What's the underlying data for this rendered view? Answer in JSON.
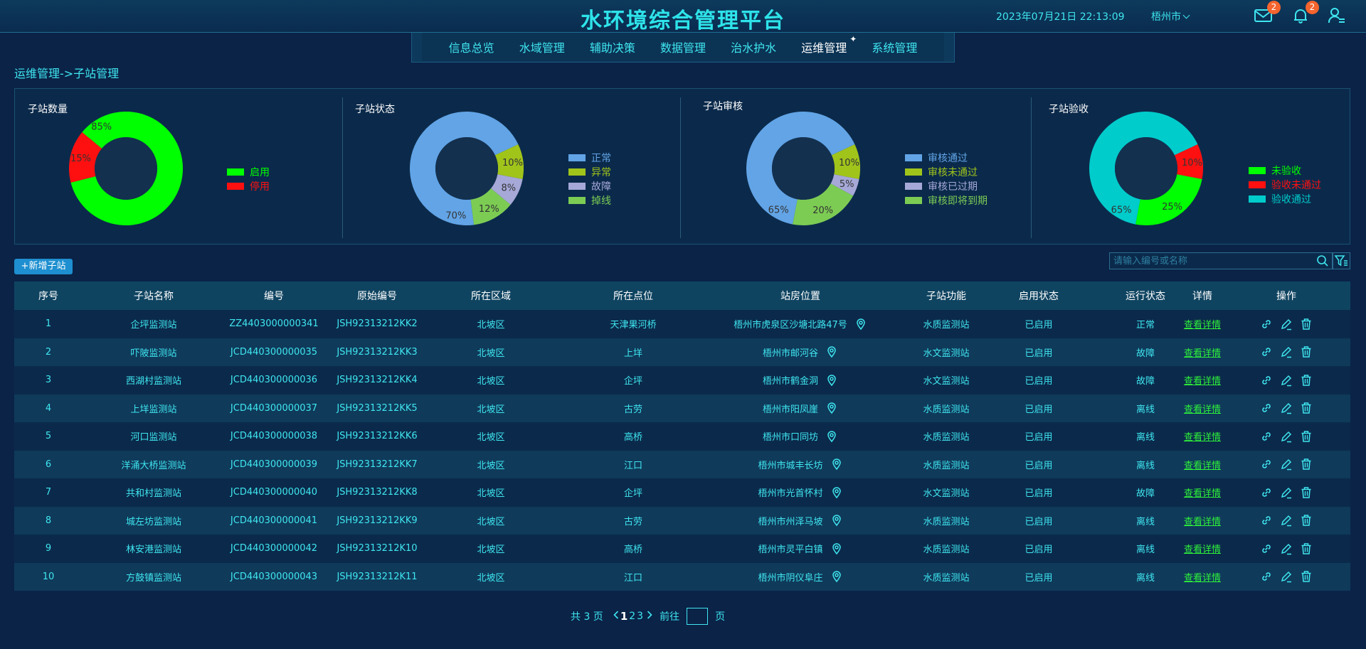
{
  "header": {
    "title": "水环境综合管理平台",
    "datetime": "2023年07月21日 22:13:09",
    "city": "梧州市",
    "mail_badge": "2",
    "bell_badge": "2"
  },
  "nav": {
    "items": [
      {
        "label": "信息总览"
      },
      {
        "label": "水域管理"
      },
      {
        "label": "辅助决策"
      },
      {
        "label": "数据管理"
      },
      {
        "label": "治水护水"
      },
      {
        "label": "运维管理",
        "active": true
      },
      {
        "label": "系统管理"
      }
    ]
  },
  "breadcrumb": "运维管理->子站管理",
  "charts": [
    {
      "title": "子站数量",
      "slices": [
        {
          "name": "启用",
          "value": 85,
          "label": "85%",
          "color": "#00ff00"
        },
        {
          "name": "停用",
          "value": 15,
          "label": "15%",
          "color": "#ff1010"
        }
      ]
    },
    {
      "title": "子站状态",
      "slices": [
        {
          "name": "正常",
          "value": 70,
          "label": "70%",
          "color": "#62a4e6"
        },
        {
          "name": "异常",
          "value": 10,
          "label": "10%",
          "color": "#a0c41a"
        },
        {
          "name": "故障",
          "value": 8,
          "label": "8%",
          "color": "#a6a8d8"
        },
        {
          "name": "掉线",
          "value": 12,
          "label": "12%",
          "color": "#7ccc54"
        }
      ]
    },
    {
      "title": "子站审核",
      "slices": [
        {
          "name": "审核通过",
          "value": 65,
          "label": "65%",
          "color": "#62a4e6"
        },
        {
          "name": "审核未通过",
          "value": 10,
          "label": "10%",
          "color": "#a0c41a"
        },
        {
          "name": "审核已过期",
          "value": 5,
          "label": "5%",
          "color": "#a6a8d8"
        },
        {
          "name": "审核即将到期",
          "value": 20,
          "label": "20%",
          "color": "#7ccc54"
        }
      ]
    },
    {
      "title": "子站验收",
      "slices": [
        {
          "name": "未验收",
          "value": 25,
          "label": "25%",
          "color": "#00ff00"
        },
        {
          "name": "验收未通过",
          "value": 10,
          "label": "10%",
          "color": "#ff1010"
        },
        {
          "name": "验收通过",
          "value": 65,
          "label": "65%",
          "color": "#00cccc"
        }
      ]
    }
  ],
  "toolbar": {
    "add_label": "+新增子站",
    "search_placeholder": "请输入编号或名称"
  },
  "table": {
    "columns": [
      "序号",
      "子站名称",
      "编号",
      "原始编号",
      "所在区域",
      "所在点位",
      "站房位置",
      "子站功能",
      "启用状态",
      "运行状态",
      "详情",
      "操作"
    ],
    "rows": [
      [
        "1",
        "企坪监测站",
        "ZZ4403000000341",
        "JSH92313212KK2",
        "北坡区",
        "天津果河桥",
        "梧州市虎泉区沙塘北路47号",
        "水质监测站",
        "已启用",
        "正常",
        "查看详情"
      ],
      [
        "2",
        "吓陂监测站",
        "JCD440300000035",
        "JSH92313212KK3",
        "北坡区",
        "上垟",
        "梧州市邮河谷",
        "水文监测站",
        "已启用",
        "故障",
        "查看详情"
      ],
      [
        "3",
        "西湖村监测站",
        "JCD440300000036",
        "JSH92313212KK4",
        "北坡区",
        "企坪",
        "梧州市鹤金洞",
        "水文监测站",
        "已启用",
        "故障",
        "查看详情"
      ],
      [
        "4",
        "上垟监测站",
        "JCD440300000037",
        "JSH92313212KK5",
        "北坡区",
        "古劳",
        "梧州市阳凤崖",
        "水质监测站",
        "已启用",
        "离线",
        "查看详情"
      ],
      [
        "5",
        "河口监测站",
        "JCD440300000038",
        "JSH92313212KK6",
        "北坡区",
        "高桥",
        "梧州市口同坊",
        "水质监测站",
        "已启用",
        "离线",
        "查看详情"
      ],
      [
        "6",
        "洋涌大桥监测站",
        "JCD440300000039",
        "JSH92313212KK7",
        "北坡区",
        "江口",
        "梧州市城丰长坊",
        "水质监测站",
        "已启用",
        "离线",
        "查看详情"
      ],
      [
        "7",
        "共和村监测站",
        "JCD440300000040",
        "JSH92313212KK8",
        "北坡区",
        "企坪",
        "梧州市光首怀村",
        "水文监测站",
        "已启用",
        "故障",
        "查看详情"
      ],
      [
        "8",
        "城左坊监测站",
        "JCD440300000041",
        "JSH92313212KK9",
        "北坡区",
        "古劳",
        "梧州市州泽马坡",
        "水质监测站",
        "已启用",
        "离线",
        "查看详情"
      ],
      [
        "9",
        "林安港监测站",
        "JCD440300000042",
        "JSH92313212K10",
        "北坡区",
        "高桥",
        "梧州市灵平白镇",
        "水质监测站",
        "已启用",
        "离线",
        "查看详情"
      ],
      [
        "10",
        "方鼓镇监测站",
        "JCD440300000043",
        "JSH92313212K11",
        "北坡区",
        "江口",
        "梧州市阴仪阜庄",
        "水质监测站",
        "已启用",
        "离线",
        "查看详情"
      ]
    ]
  },
  "pagination": {
    "total_text": "共 3 页",
    "pages": [
      "1",
      "2",
      "3"
    ],
    "current": "1",
    "goto_label": "前往",
    "page_suffix": "页"
  }
}
